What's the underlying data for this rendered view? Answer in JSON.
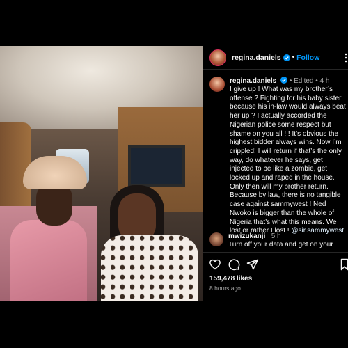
{
  "post": {
    "username": "regina.daniels",
    "follow_label": "Follow",
    "separator": "•",
    "caption": {
      "username": "regina.daniels",
      "edited_label": "Edited",
      "time": "4 h",
      "text": "I give up ! What was my brother’s offense ? Fighting for his baby sister because his in-law would always beat her up ? I actually accorded the Nigerian police some respect but shame on you all !!! It’s obvious the highest bidder always wins. Now I’m crippled! I will return if that’s the only way, do whatever he says, get injected to be like a zombie, get locked up and raped in the house. Only then will my brother return. Because by law, there is no tangible case against sammywest ! Ned Nwoko is bigger than the whole of Nigeria that’s what this means. We lost or rather I lost ! ",
      "mention": "@sir.sammywest"
    },
    "comment": {
      "username": "mwizukanji_",
      "time": "5 h",
      "text": "Turn off your data and get on your"
    },
    "likes": "159,478 likes",
    "time_ago": "8 hours ago"
  },
  "icons": {
    "like": "heart-icon",
    "comment": "comment-icon",
    "share": "share-icon",
    "save": "bookmark-icon",
    "verified": "verified-badge-icon",
    "more": "more-options-icon"
  },
  "colors": {
    "accent": "#0095f6",
    "background": "#000000",
    "verified": "#0095f6"
  }
}
